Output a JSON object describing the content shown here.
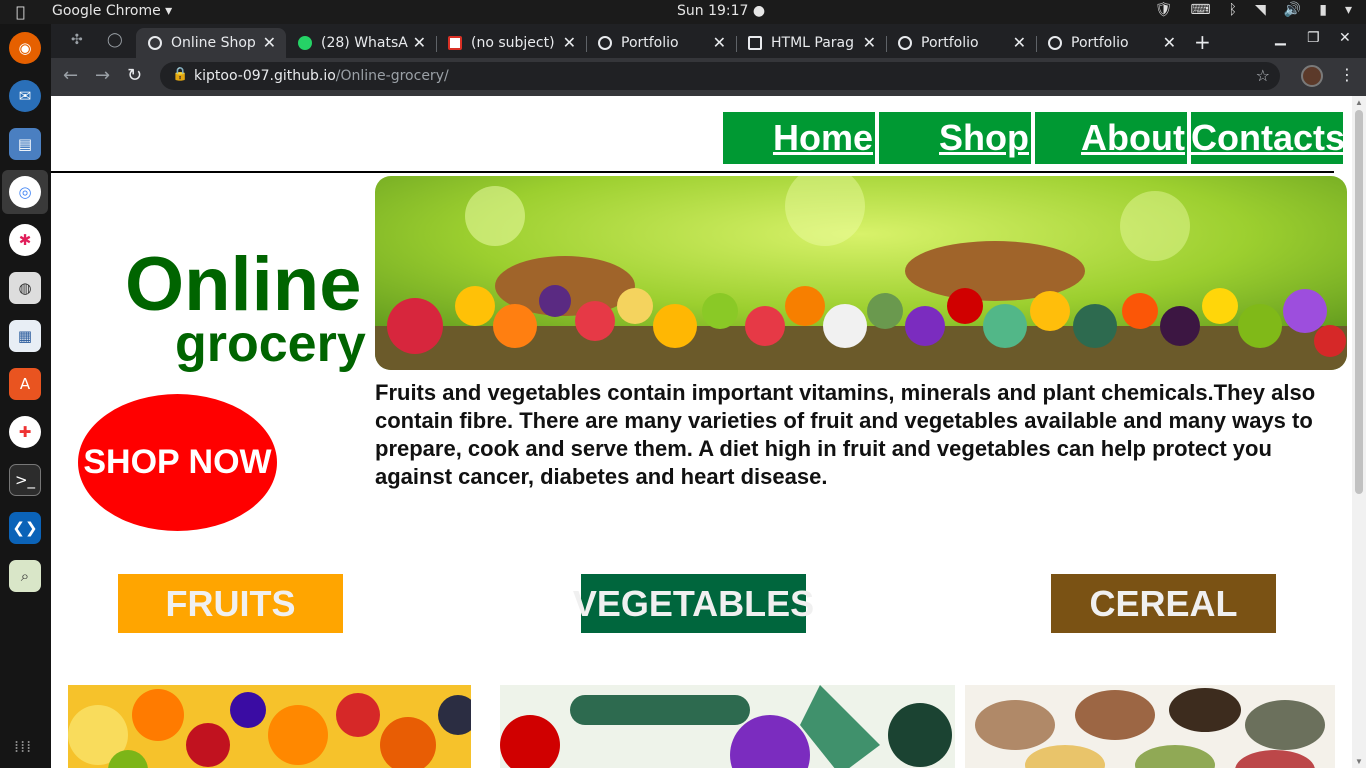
{
  "system": {
    "app_name": "Google Chrome",
    "clock": "Sun 19:17"
  },
  "browser": {
    "tabs": [
      {
        "label": "Online Shop",
        "icon": "globe-icon",
        "active": true
      },
      {
        "label": "(28) WhatsA",
        "icon": "whatsapp-icon",
        "active": false
      },
      {
        "label": "(no subject)",
        "icon": "gmail-icon",
        "active": false
      },
      {
        "label": "Portfolio",
        "icon": "globe-icon",
        "active": false
      },
      {
        "label": "HTML Parag",
        "icon": "html-icon",
        "active": false
      },
      {
        "label": "Portfolio",
        "icon": "globe-icon",
        "active": false
      },
      {
        "label": "Portfolio",
        "icon": "globe-icon",
        "active": false
      }
    ],
    "url_host": "kiptoo-097.github.io",
    "url_path": "/Online-grocery/"
  },
  "site": {
    "nav": {
      "home": "Home",
      "shop": "Shop",
      "about": "About",
      "contacts": "Contacts"
    },
    "title_line1": "Online",
    "title_line2": "grocery",
    "cta": "SHOP NOW",
    "description": "Fruits and vegetables contain important vitamins, minerals and plant chemicals.They also contain fibre. There are many varieties of fruit and vegetables available and many ways to prepare, cook and serve them. A diet high in fruit and vegetables can help protect you against cancer, diabetes and heart disease.",
    "categories": {
      "fruits": "FRUITS",
      "vegetables": "VEGETABLES",
      "cereal": "CEREAL"
    },
    "colors": {
      "nav_green": "#009933",
      "title_green": "#006400",
      "cta_red": "#ff0000",
      "fruits_orange": "#ffa500",
      "vegetables_green": "#00663d",
      "cereal_brown": "#7a5214"
    }
  }
}
